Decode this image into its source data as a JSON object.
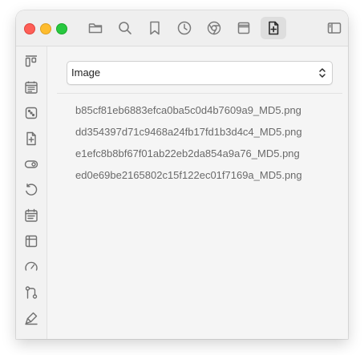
{
  "window": {
    "traffic_lights": [
      "close",
      "minimize",
      "zoom"
    ]
  },
  "toolbar": {
    "buttons": [
      {
        "icon": "folder-icon",
        "active": false
      },
      {
        "icon": "search-icon",
        "active": false
      },
      {
        "icon": "bookmark-icon",
        "active": false
      },
      {
        "icon": "clock-icon",
        "active": false
      },
      {
        "icon": "chrome-icon",
        "active": false
      },
      {
        "icon": "window-icon",
        "active": false
      },
      {
        "icon": "add-document-icon",
        "active": true
      },
      {
        "icon": "sidebar-toggle-icon",
        "active": false
      }
    ]
  },
  "sidebar": {
    "icons": [
      "layout-columns-icon",
      "calendar-icon",
      "dice-icon",
      "add-file-icon",
      "toggle-icon",
      "undo-icon",
      "calendar-list-icon",
      "table-icon",
      "gauge-icon",
      "branch-icon",
      "highlighter-icon"
    ]
  },
  "main": {
    "filter_select": {
      "selected": "Image"
    },
    "files": [
      "b85cf81eb6883efca0ba5c0d4b7609a9_MD5.png",
      "dd354397d71c9468a24fb17fd1b3d4c4_MD5.png",
      "e1efc8b8bf67f01ab22eb2da854a9a76_MD5.png",
      "ed0e69be2165802c15f122ec01f7169a_MD5.png"
    ]
  },
  "colors": {
    "close": "#fe5f57",
    "minimize": "#febc2e",
    "zoom": "#28c840",
    "window_bg": "#f5f5f5",
    "text_muted": "#6a6a6a"
  }
}
